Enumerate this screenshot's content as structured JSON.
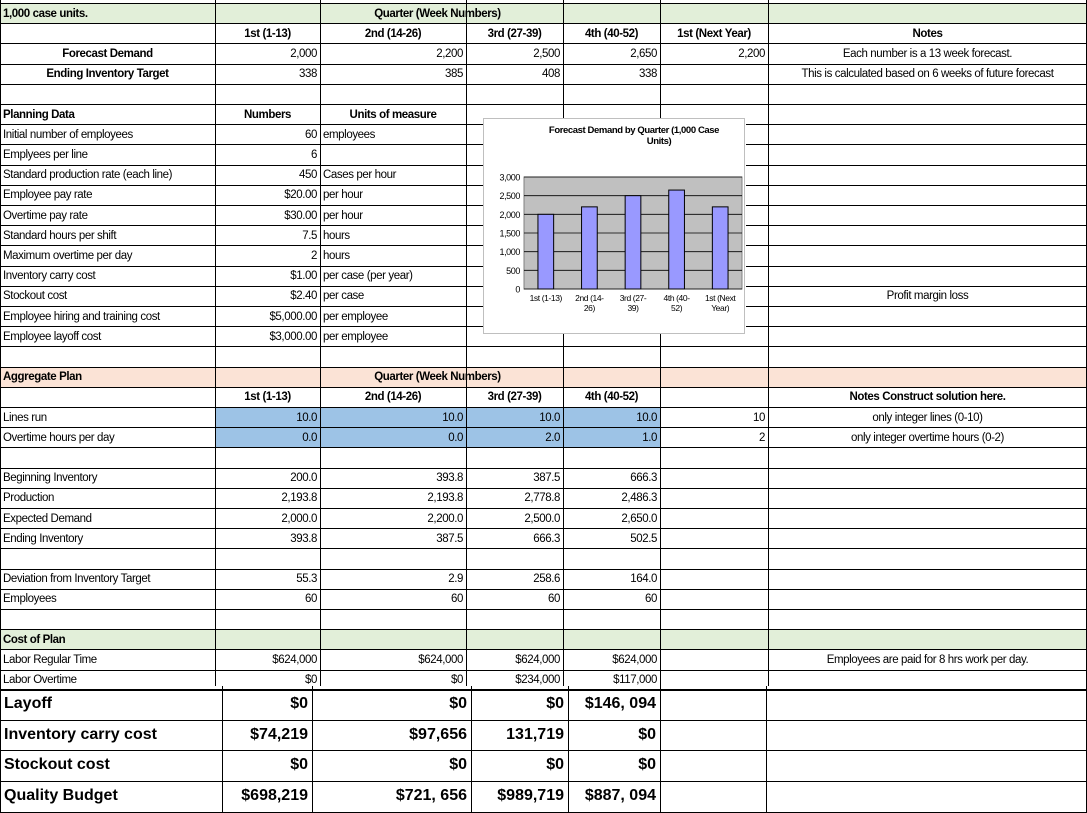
{
  "header": {
    "units_label": "1,000 case units.",
    "quarter_group": "Quarter (Week Numbers)",
    "columns": [
      "1st (1-13)",
      "2nd (14-26)",
      "3rd (27-39)",
      "4th (40-52)",
      "1st (Next Year)"
    ],
    "notes_label": "Notes"
  },
  "forecast": [
    {
      "label": "Forecast Demand",
      "values": [
        "2,000",
        "2,200",
        "2,500",
        "2,650",
        "2,200"
      ],
      "note": "Each number is a 13 week forecast."
    },
    {
      "label": "Ending Inventory Target",
      "values": [
        "338",
        "385",
        "408",
        "338",
        ""
      ],
      "note": "This is calculated based on 6 weeks of future forecast"
    }
  ],
  "planning": {
    "title": "Planning Data",
    "numbers_header": "Numbers",
    "units_header": "Units of measure",
    "rows": [
      {
        "label": "Initial number of employees",
        "value": "60",
        "unit": "employees",
        "note": ""
      },
      {
        "label": "Emplyees per line",
        "value": "6",
        "unit": "",
        "note": ""
      },
      {
        "label": "Standard production rate (each line)",
        "value": "450",
        "unit": "Cases per hour",
        "note": ""
      },
      {
        "label": "Employee pay rate",
        "value": "$20.00",
        "unit": "per hour",
        "note": ""
      },
      {
        "label": "Overtime pay rate",
        "value": "$30.00",
        "unit": "per hour",
        "note": ""
      },
      {
        "label": "Standard hours per shift",
        "value": "7.5",
        "unit": "hours",
        "note": ""
      },
      {
        "label": "Maximum overtime per day",
        "value": "2",
        "unit": "hours",
        "note": ""
      },
      {
        "label": "Inventory carry cost",
        "value": "$1.00",
        "unit": "per case (per year)",
        "note": ""
      },
      {
        "label": "Stockout cost",
        "value": "$2.40",
        "unit": "per case",
        "note": "Profit margin loss"
      },
      {
        "label": "Employee hiring and training cost",
        "value": "$5,000.00",
        "unit": "per employee",
        "note": ""
      },
      {
        "label": "Employee layoff cost",
        "value": "$3,000.00",
        "unit": "per employee",
        "note": ""
      }
    ]
  },
  "aggregate": {
    "title": "Aggregate Plan",
    "quarter_group": "Quarter (Week Numbers)",
    "columns": [
      "1st (1-13)",
      "2nd (14-26)",
      "3rd (27-39)",
      "4th (40-52)"
    ],
    "notes_label": "Notes  Construct solution here.",
    "input_rows": [
      {
        "label": "Lines run",
        "values": [
          "10.0",
          "10.0",
          "10.0",
          "10.0"
        ],
        "extra": "10",
        "note": "only integer lines (0-10)"
      },
      {
        "label": "Overtime hours per day",
        "values": [
          "0.0",
          "0.0",
          "2.0",
          "1.0"
        ],
        "extra": "2",
        "note": "only integer overtime hours  (0-2)"
      }
    ],
    "inventory_rows": [
      {
        "label": "Beginning Inventory",
        "values": [
          "200.0",
          "393.8",
          "387.5",
          "666.3"
        ]
      },
      {
        "label": "Production",
        "values": [
          "2,193.8",
          "2,193.8",
          "2,778.8",
          "2,486.3"
        ]
      },
      {
        "label": "Expected Demand",
        "values": [
          "2,000.0",
          "2,200.0",
          "2,500.0",
          "2,650.0"
        ]
      },
      {
        "label": "Ending Inventory",
        "values": [
          "393.8",
          "387.5",
          "666.3",
          "502.5"
        ]
      }
    ],
    "deviation_rows": [
      {
        "label": "Deviation from Inventory Target",
        "values": [
          "55.3",
          "2.9",
          "258.6",
          "164.0"
        ]
      },
      {
        "label": "Employees",
        "values": [
          "60",
          "60",
          "60",
          "60"
        ]
      }
    ]
  },
  "cost": {
    "title": "Cost of Plan",
    "rows": [
      {
        "label": "Labor Regular Time",
        "values": [
          "$624,000",
          "$624,000",
          "$624,000",
          "$624,000"
        ],
        "note": "Employees are paid for 8 hrs work per day."
      },
      {
        "label": "Labor Overtime",
        "values": [
          "$0",
          "$0",
          "$234,000",
          "$117,000"
        ],
        "note": ""
      }
    ]
  },
  "summary": {
    "rows": [
      {
        "label": "Layoff",
        "values": [
          "$0",
          "$0",
          "$0",
          "$146, 094"
        ]
      },
      {
        "label": "Inventory carry cost",
        "values": [
          "$74,219",
          "$97,656",
          "131,719",
          "$0"
        ]
      },
      {
        "label": "Stockout cost",
        "values": [
          "$0",
          "$0",
          "$0",
          "$0"
        ]
      },
      {
        "label": "Quality Budget",
        "values": [
          "$698,219",
          "$721, 656",
          "$989,719",
          "$887, 094"
        ]
      }
    ]
  },
  "colors": {
    "header_band": "#e2efd9",
    "aggregate_band": "#fbe3d6",
    "input_cells": "#9dc3e6",
    "bar_fill": "#9999ff",
    "plot_area": "#c0c0c0"
  },
  "chart_data": {
    "type": "bar",
    "title": "Forecast Demand by Quarter (1,000 Case Units)",
    "categories": [
      "1st (1-13)",
      "2nd (14-26)",
      "3rd (27-39)",
      "4th (40-52)",
      "1st (Next Year)"
    ],
    "category_lines": [
      [
        "1st (1-13)"
      ],
      [
        "2nd (14-",
        "26)"
      ],
      [
        "3rd (27-",
        "39)"
      ],
      [
        "4th (40-",
        "52)"
      ],
      [
        "1st (Next",
        "Year)"
      ]
    ],
    "values": [
      2000,
      2200,
      2500,
      2650,
      2200
    ],
    "ylim": [
      0,
      3000
    ],
    "yticks": [
      "0",
      "500",
      "1,000",
      "1,500",
      "2,000",
      "2,500",
      "3,000"
    ],
    "ytick_values": [
      0,
      500,
      1000,
      1500,
      2000,
      2500,
      3000
    ],
    "grid": true,
    "legend": "none"
  }
}
